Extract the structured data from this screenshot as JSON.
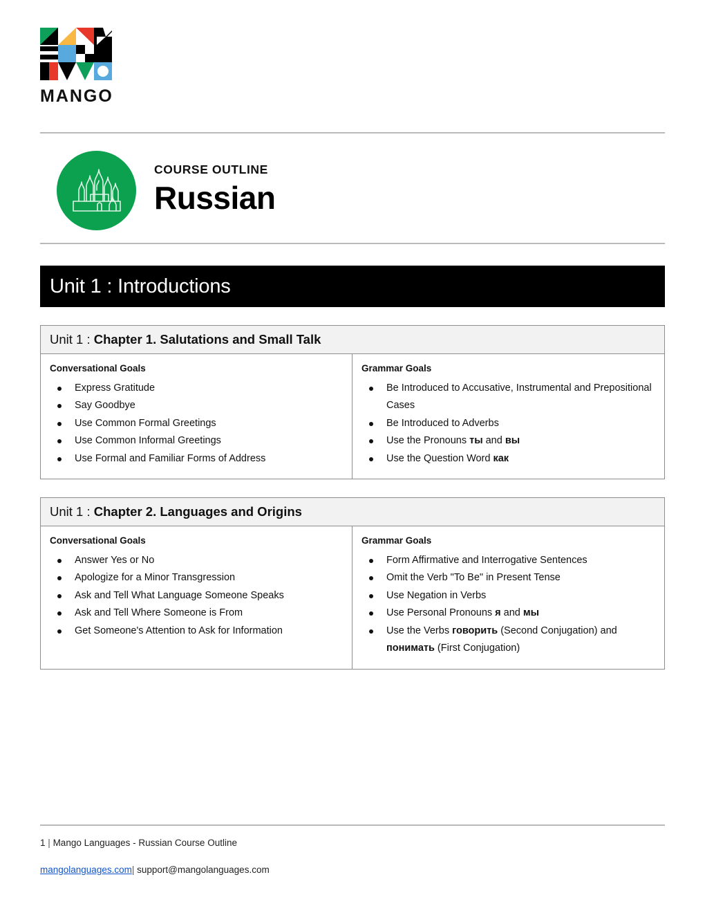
{
  "brand": {
    "wordmark": "MANGO",
    "logo_icon": "mango-mosaic-logo",
    "colors": {
      "green": "#0EA05A",
      "yellow": "#F9B743",
      "red": "#E8382B",
      "blue": "#58A9DE",
      "black": "#000000",
      "white": "#FFFFFF"
    }
  },
  "course": {
    "eyebrow": "COURSE OUTLINE",
    "title": "Russian",
    "badge_icon": "cathedral-icon",
    "badge_color": "#0BA14E"
  },
  "unit": {
    "banner_label": "Unit 1 : Introductions"
  },
  "chapters": [
    {
      "unit_prefix": "Unit 1 : ",
      "title": "Chapter 1. Salutations and Small Talk",
      "conversational": {
        "heading": "Conversational Goals",
        "items": [
          [
            {
              "t": "Express Gratitude"
            }
          ],
          [
            {
              "t": "Say Goodbye"
            }
          ],
          [
            {
              "t": "Use Common Formal Greetings"
            }
          ],
          [
            {
              "t": "Use Common Informal Greetings"
            }
          ],
          [
            {
              "t": "Use Formal and Familiar Forms of Address"
            }
          ]
        ]
      },
      "grammar": {
        "heading": "Grammar Goals",
        "items": [
          [
            {
              "t": "Be Introduced to Accusative, Instrumental and Prepositional Cases"
            }
          ],
          [
            {
              "t": "Be Introduced to Adverbs"
            }
          ],
          [
            {
              "t": "Use the Pronouns "
            },
            {
              "t": "ты",
              "b": true
            },
            {
              "t": " and "
            },
            {
              "t": "вы",
              "b": true
            }
          ],
          [
            {
              "t": "Use the Question Word "
            },
            {
              "t": "как",
              "b": true
            }
          ]
        ]
      }
    },
    {
      "unit_prefix": "Unit 1 : ",
      "title": "Chapter 2. Languages and Origins",
      "conversational": {
        "heading": "Conversational Goals",
        "items": [
          [
            {
              "t": "Answer Yes or No"
            }
          ],
          [
            {
              "t": "Apologize for a Minor Transgression"
            }
          ],
          [
            {
              "t": "Ask and Tell What Language Someone Speaks"
            }
          ],
          [
            {
              "t": "Ask and Tell Where Someone is From"
            }
          ],
          [
            {
              "t": "Get Someone's Attention to Ask for Information"
            }
          ]
        ]
      },
      "grammar": {
        "heading": "Grammar Goals",
        "items": [
          [
            {
              "t": "Form Affirmative and Interrogative Sentences"
            }
          ],
          [
            {
              "t": "Omit the Verb \"To Be\" in Present Tense"
            }
          ],
          [
            {
              "t": "Use Negation in Verbs"
            }
          ],
          [
            {
              "t": "Use Personal Pronouns "
            },
            {
              "t": "я",
              "b": true
            },
            {
              "t": " and "
            },
            {
              "t": "мы",
              "b": true
            }
          ],
          [
            {
              "t": "Use the Verbs "
            },
            {
              "t": "говорить",
              "b": true
            },
            {
              "t": " (Second Conjugation) and "
            },
            {
              "t": "понимать",
              "b": true
            },
            {
              "t": " (First Conjugation)"
            }
          ]
        ]
      }
    }
  ],
  "footer": {
    "page_number": "1",
    "divider": "|",
    "document_title": "Mango Languages - Russian Course Outline",
    "website": "mangolanguages.com",
    "email": "support@mangolanguages.com",
    "link_color": "#1155CC"
  }
}
